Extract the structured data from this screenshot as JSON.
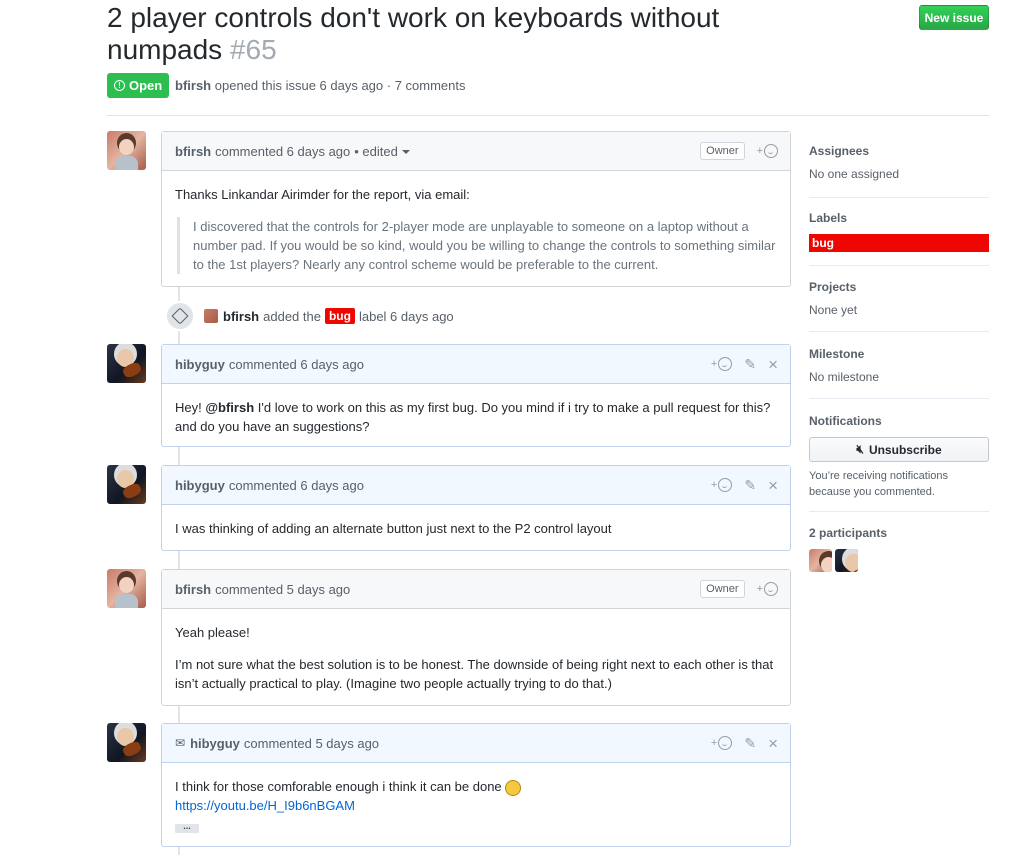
{
  "issue": {
    "title": "2 player controls don't work on keyboards without numpads",
    "number": "#65",
    "state": "Open",
    "author": "bfirsh",
    "meta_text": "opened this issue 6 days ago · 7 comments",
    "new_issue_label": "New issue"
  },
  "comments": [
    {
      "author": "bfirsh",
      "time": "commented 6 days ago",
      "edited": "• edited",
      "badge": "Owner",
      "intro": "Thanks Linkandar Airimder for the report, via email:",
      "quote": "I discovered that the controls for 2-player mode are unplayable to someone on a laptop without a number pad. If you would be so kind, would you be willing to change the controls to something similar to the 1st players? Nearly any control scheme would be preferable to the current."
    },
    {
      "author": "hibyguy",
      "time": "commented 6 days ago",
      "mention": "@bfirsh",
      "body_before": "Hey! ",
      "body_after": " I'd love to work on this as my first bug. Do you mind if i try to make a pull request for this? and do you have an suggestions?"
    },
    {
      "author": "hibyguy",
      "time": "commented 6 days ago",
      "body": "I was thinking of adding an alternate button just next to the P2 control layout"
    },
    {
      "author": "bfirsh",
      "time": "commented 5 days ago",
      "badge": "Owner",
      "p1": "Yeah please!",
      "p2": "I’m not sure what the best solution is to be honest. The downside of being right next to each other is that isn’t actually practical to play. (Imagine two people actually trying to do that.)"
    },
    {
      "author": "hibyguy",
      "time": "commented 5 days ago",
      "body": "I think for those comforable enough i think it can be done",
      "link": "https://youtu.be/H_I9b6nBGAM",
      "ellipsis": "..."
    }
  ],
  "event": {
    "actor": "bfirsh",
    "text_before": "added the",
    "label": "bug",
    "text_after": "label 6 days ago"
  },
  "sidebar": {
    "assignees_title": "Assignees",
    "assignees_value": "No one assigned",
    "labels_title": "Labels",
    "label_bug": "bug",
    "projects_title": "Projects",
    "projects_value": "None yet",
    "milestone_title": "Milestone",
    "milestone_value": "No milestone",
    "notifications_title": "Notifications",
    "unsubscribe_label": "Unsubscribe",
    "notifications_reason": "You’re receiving notifications because you commented.",
    "participants_title": "2 participants"
  },
  "colors": {
    "open_green": "#2cbe4e",
    "bug_red": "#ee0701",
    "link_blue": "#0366d6"
  }
}
